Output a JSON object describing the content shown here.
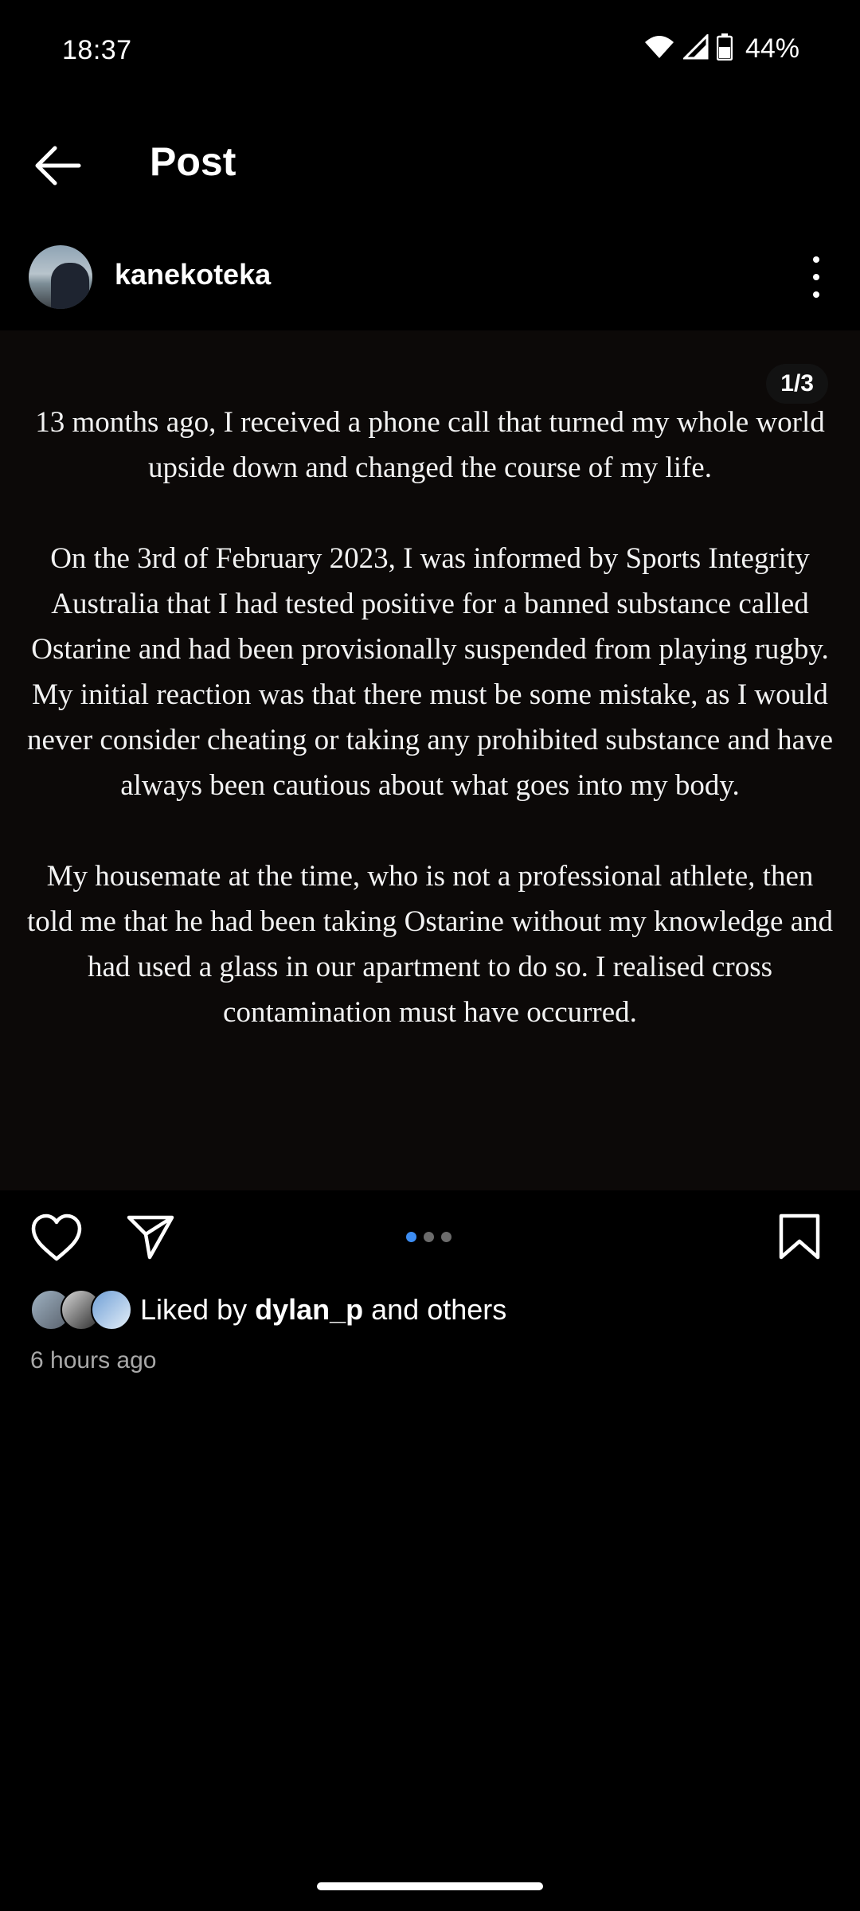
{
  "status_bar": {
    "time": "18:37",
    "battery_percent": "44%",
    "icons": [
      "wifi-icon",
      "signal-icon",
      "battery-icon"
    ]
  },
  "header": {
    "title": "Post",
    "back_icon": "arrow-left-icon"
  },
  "author": {
    "username": "kanekoteka",
    "menu_icon": "more-vertical-icon"
  },
  "post": {
    "page_indicator": "1/3",
    "paragraphs": [
      "13 months ago, I received a phone call that turned my whole world upside down and changed the course of my life.",
      "On the 3rd of February 2023, I was informed by Sports Integrity Australia that I had tested positive for a banned substance called Ostarine and had been provisionally suspended from playing rugby.  My initial reaction was that there must be some mistake, as I would never consider cheating or taking any prohibited substance and have always been cautious about what goes into my body.",
      "My housemate at the time, who is not a professional athlete, then told me that he had been taking Ostarine without my knowledge and had used a glass in our apartment to do so. I realised cross contamination must have occurred."
    ],
    "carousel_total": 3,
    "carousel_active": 1
  },
  "actions": {
    "icons": [
      "heart-icon",
      "send-icon",
      "bookmark-icon"
    ]
  },
  "likes": {
    "prefix": "Liked by ",
    "user": "dylan_p",
    "suffix": " and others"
  },
  "timestamp": "6 hours ago",
  "colors": {
    "background": "#000000",
    "media_background": "#0c0908",
    "accent_dot": "#3d8df2",
    "secondary_text": "#a8a8a8"
  }
}
